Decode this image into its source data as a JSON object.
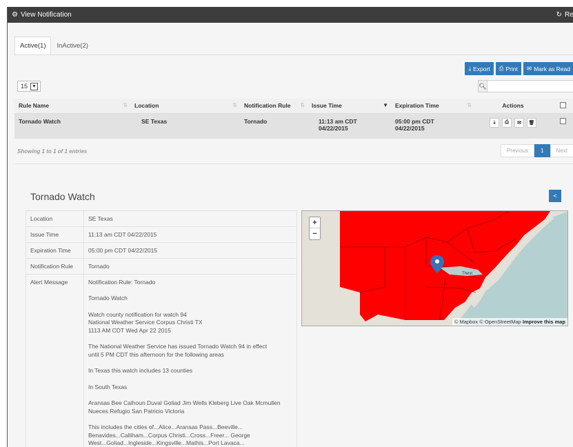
{
  "window": {
    "title": "View Notification",
    "refresh_label": "Refresh"
  },
  "tabs": [
    {
      "label": "Active(1)"
    },
    {
      "label": "InActive(2)"
    }
  ],
  "toolbar": {
    "export_label": "Export",
    "print_label": "Print",
    "mark_read_label": "Mark as Read"
  },
  "page_size": "15",
  "search": {
    "placeholder": ""
  },
  "table": {
    "headers": [
      "Rule Name",
      "Location",
      "Notification Rule",
      "Issue Time",
      "Expiration Time",
      "Actions"
    ],
    "rows": [
      {
        "rule_name": "Tornado Watch",
        "location": "SE Texas",
        "notification_rule": "Tornado",
        "issue_time": "11:13 am CDT\n04/22/2015",
        "expiration_time": "05:00 pm CDT\n04/22/2015"
      }
    ]
  },
  "info_text": "Showing 1 to 1 of 1 entries",
  "pager": {
    "previous": "Previous",
    "current": "1",
    "next": "Next"
  },
  "detail": {
    "title": "Tornado Watch",
    "rows": [
      {
        "key": "Location",
        "value": "SE Texas"
      },
      {
        "key": "Issue Time",
        "value": "11:13 am CDT 04/22/2015"
      },
      {
        "key": "Expiration Time",
        "value": "05:00 pm CDT 04/22/2015"
      },
      {
        "key": "Notification Rule",
        "value": "Tornado"
      }
    ],
    "alert_key": "Alert Message",
    "alert_paragraphs": [
      "Notification Rule: Tornado",
      "Tornado Watch",
      "Watch county notification for watch 94\nNational Weather Service Corpus Christi TX\n1113 AM CDT Wed Apr 22 2015",
      "The National Weather Service has issued Tornado Watch 94 in effect\nuntil 5 PM CDT this afternoon for the following areas",
      "In Texas this watch includes 13 counties",
      "In South Texas",
      "Aransas Bee Calhoun Duval Goliad Jim Wells Kleberg Live Oak Mcmullen\nNueces Refugio San Patricio Victoria",
      "This includes the cities of...Alice...Aransas Pass...Beeville...\nBenavides...Calliham...Corpus Christi...Cross...Freer... George\nWest...Goliad...Ingleside...Kingsville...Mathis...Port Lavaca..."
    ]
  },
  "map": {
    "attribution_prefix": "© Mapbox © OpenStreetMap",
    "attribution_link": "Improve this map",
    "place_label": "Thest",
    "land_color": "#e4e1d8",
    "water_color": "#b5d0d0",
    "alert_color": "#ff0000"
  }
}
